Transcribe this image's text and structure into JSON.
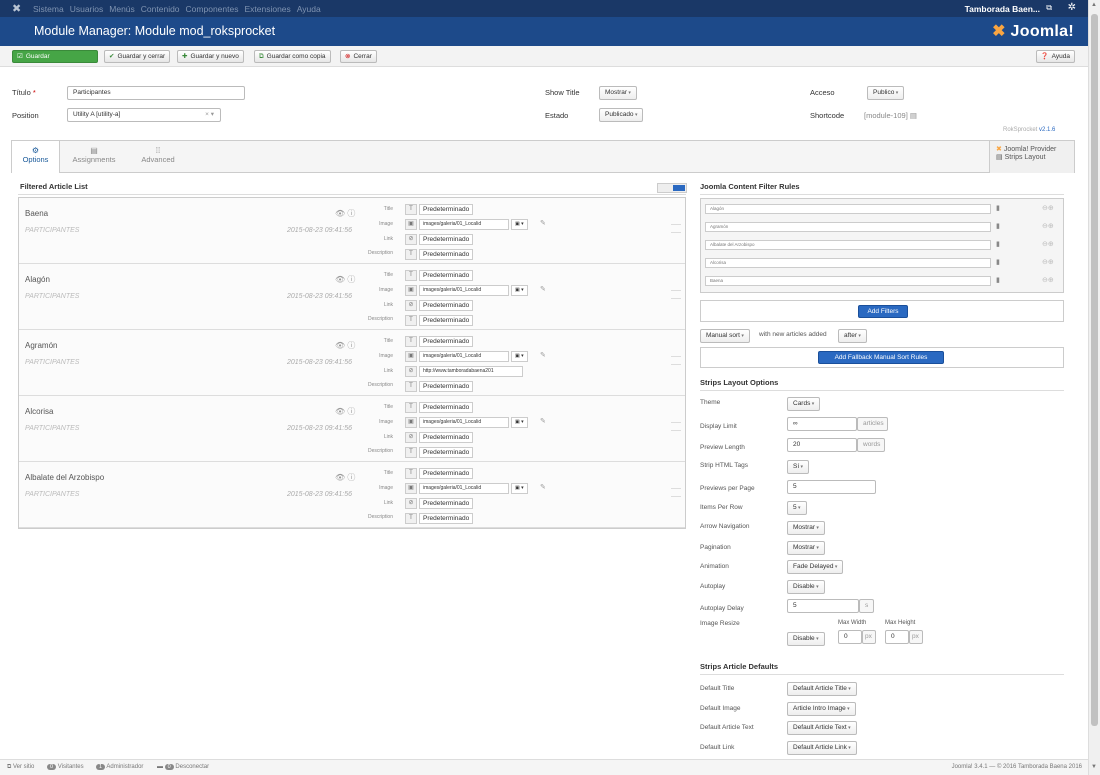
{
  "topnav": {
    "logo_icon": "joomla-x-icon",
    "menu": [
      "Sistema",
      "Usuarios",
      "Menús",
      "Contenido",
      "Componentes",
      "Extensiones",
      "Ayuda"
    ],
    "user": "Tamborada Baen...",
    "external_icon": "external-link-icon",
    "gear_icon": "gear-icon"
  },
  "header": {
    "title": "Module Manager: Module mod_roksprocket",
    "brand": "Joomla!"
  },
  "toolbar": {
    "save": "Guardar",
    "save_close": "Guardar y cerrar",
    "save_new": "Guardar y nuevo",
    "save_copy": "Guardar como copia",
    "close": "Cerrar",
    "help": "Ayuda"
  },
  "form": {
    "title_label": "Título",
    "required_mark": "*",
    "title_value": "Participantes",
    "position_label": "Position",
    "position_value": "Utility A [utility-a]",
    "position_clear": "× ▾",
    "show_title_label": "Show Title",
    "show_title_value": "Mostrar",
    "state_label": "Estado",
    "state_value": "Publicado",
    "access_label": "Acceso",
    "access_value": "Publico",
    "shortcode_label": "Shortcode",
    "shortcode_value": "[module-109]",
    "roksprocket": "RokSprocket",
    "version": "v2.1.6"
  },
  "tabs": [
    {
      "label": "Options",
      "icon": "⚙"
    },
    {
      "label": "Assignments",
      "icon": "▤"
    },
    {
      "label": "Advanced",
      "icon": "⁞⁞"
    }
  ],
  "provider": {
    "provider": "Joomla! Provider",
    "layout": "Strips Layout"
  },
  "articles_section": {
    "title": "Filtered Article List",
    "field_labels": {
      "title": "Title",
      "image": "Image",
      "link": "Link",
      "description": "Description"
    },
    "default_value": "Predeterminado",
    "items": [
      {
        "name": "Baena",
        "category": "PARTICIPANTES",
        "date": "2015-08-23 09:41:56",
        "image": "images/galeria/01_Localid",
        "link": "Predeterminado"
      },
      {
        "name": "Alagón",
        "category": "PARTICIPANTES",
        "date": "2015-08-23 09:41:56",
        "image": "images/galeria/01_Localid",
        "link": "Predeterminado"
      },
      {
        "name": "Agramón",
        "category": "PARTICIPANTES",
        "date": "2015-08-23 09:41:56",
        "image": "images/galeria/01_Localid",
        "link": "http://www.tamboradabaena201"
      },
      {
        "name": "Alcorisa",
        "category": "PARTICIPANTES",
        "date": "2015-08-23 09:41:56",
        "image": "images/galeria/01_Localid",
        "link": "Predeterminado"
      },
      {
        "name": "Albalate del Arzobispo",
        "category": "PARTICIPANTES",
        "date": "2015-08-23 09:41:56",
        "image": "images/galeria/01_Localid",
        "link": "Predeterminado"
      }
    ]
  },
  "filters_section": {
    "title": "Joomla Content Filter Rules",
    "rules": [
      "Alagón",
      "Agramón",
      "Albalate del Arzobispo",
      "Alcorisa",
      "Baena"
    ],
    "add_filters": "Add Filters",
    "sort_value": "Manual sort",
    "sort_text": "with new articles added",
    "sort_after": "after",
    "add_fallback": "Add Fallback Manual Sort Rules"
  },
  "strips_section": {
    "title": "Strips Layout Options",
    "theme_label": "Theme",
    "theme_value": "Cards",
    "display_limit_label": "Display Limit",
    "display_limit_value": "∞",
    "display_limit_unit": "articles",
    "preview_length_label": "Preview Length",
    "preview_length_value": "20",
    "preview_length_unit": "words",
    "strip_html_label": "Strip HTML Tags",
    "strip_html_value": "Sí",
    "previews_per_page_label": "Previews per Page",
    "previews_per_page_value": "5",
    "items_per_row_label": "Items Per Row",
    "items_per_row_value": "5",
    "arrow_nav_label": "Arrow Navigation",
    "arrow_nav_value": "Mostrar",
    "pagination_label": "Pagination",
    "pagination_value": "Mostrar",
    "animation_label": "Animation",
    "animation_value": "Fade Delayed",
    "autoplay_label": "Autoplay",
    "autoplay_value": "Disable",
    "autoplay_delay_label": "Autoplay Delay",
    "autoplay_delay_value": "5",
    "autoplay_delay_unit": "s",
    "image_resize_label": "Image Resize",
    "image_resize_value": "Disable",
    "max_width_label": "Max Width",
    "max_width_value": "0",
    "max_height_label": "Max Height",
    "max_height_value": "0",
    "px": "px"
  },
  "defaults_section": {
    "title": "Strips Article Defaults",
    "default_title_label": "Default Title",
    "default_title_value": "Default Article Title",
    "default_image_label": "Default Image",
    "default_image_value": "Article Intro Image",
    "default_text_label": "Default Article Text",
    "default_text_value": "Default Article Text",
    "default_link_label": "Default Link",
    "default_link_value": "Default Article Link"
  },
  "statusbar": {
    "view_site": "Ver sitio",
    "visitors_count": "0",
    "visitors": "Visitantes",
    "admin_count": "1",
    "admin": "Administrador",
    "logout_count": "0",
    "logout": "Desconectar",
    "footer": "Joomla! 3.4.1 — © 2016 Tamborada Baena 2016"
  }
}
